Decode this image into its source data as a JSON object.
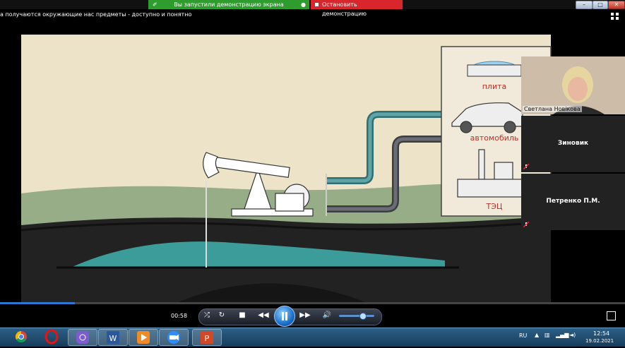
{
  "topbar": {
    "share_status": "Вы запустили демонстрацию экрана",
    "stop_share": "Остановить демонстрацию",
    "win_min": "–",
    "win_max": "□",
    "win_close": "✕"
  },
  "page": {
    "title": "а получаются окружающие нас предметы - доступно и понятно"
  },
  "video": {
    "labels": {
      "stove": "плита",
      "car": "автомобиль",
      "power_plant": "ТЭЦ"
    },
    "colors": {
      "sky": "#ede3c8",
      "grass": "#97ad88",
      "water": "#3b9c9a",
      "rock": "#1e1e1e",
      "panel": "#f1eadb",
      "label_red": "#b8322a"
    }
  },
  "player": {
    "time": "00:58",
    "progress": 0.12,
    "volume": 0.65,
    "colors": {
      "progress": "#2a76d2"
    }
  },
  "participants": [
    {
      "name": "Светлана Новікова",
      "video": true
    },
    {
      "name": "Зиновик",
      "video": false
    },
    {
      "name": "Петренко П.М.",
      "video": false
    }
  ],
  "taskbar": {
    "lang": "RU",
    "time": "12:54",
    "date": "19.02.2021",
    "apps": [
      "chrome-icon",
      "opera-icon",
      "viber-icon",
      "word-icon",
      "media-player-icon",
      "zoom-icon",
      "powerpoint-icon"
    ]
  }
}
